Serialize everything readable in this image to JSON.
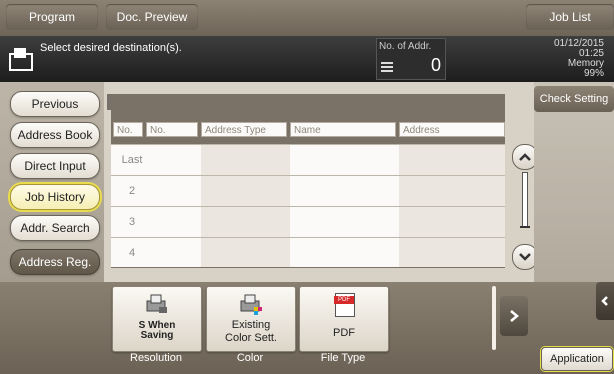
{
  "top_tabs": {
    "program": "Program",
    "doc_preview": "Doc. Preview",
    "job_list": "Job List"
  },
  "message": "Select desired destination(s).",
  "address_count": {
    "label": "No. of Addr.",
    "value": "0"
  },
  "status": {
    "date": "01/12/2015",
    "time": "01:25",
    "memory_label": "Memory",
    "memory_value": "99%"
  },
  "sidebar": {
    "previous": "Previous",
    "address_book": "Address Book",
    "direct_input": "Direct Input",
    "job_history": "Job History",
    "addr_search": "Addr. Search",
    "address_reg": "Address Reg."
  },
  "check_setting": "Check Setting",
  "table": {
    "headers": [
      "No.",
      "No.",
      "Address Type",
      "Name",
      "Address"
    ],
    "rows": [
      "Last",
      "2",
      "3",
      "4"
    ]
  },
  "functions": [
    {
      "tile_text_1": "S When",
      "tile_text_2": "Saving",
      "label": "Resolution"
    },
    {
      "tile_text_1": "Existing",
      "tile_text_2": "Color Sett.",
      "label": "Color"
    },
    {
      "tile_text_1": "PDF",
      "tile_text_2": "",
      "label": "File Type",
      "icon_text": "PDF"
    }
  ],
  "application_button": "Application",
  "colors": {
    "accent_yellow": "#e9dc4c",
    "dark_bar": "#1d1d1d",
    "frame_taupe": "#7a7266"
  },
  "icons": [
    "document-icon",
    "list-icon",
    "chevron-up-icon",
    "chevron-down-icon",
    "chevron-right-icon",
    "chevron-left-icon",
    "scanner-settings-icon",
    "color-settings-icon",
    "pdf-icon"
  ]
}
